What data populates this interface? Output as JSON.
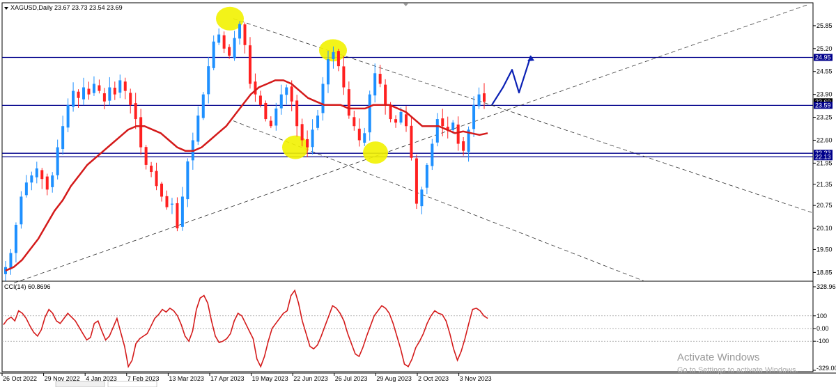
{
  "header": {
    "symbol_line": "XAGUSD,Daily  23.67 23.73 23.54 23.69"
  },
  "indicator": {
    "label": "CCI(14) 60.8696"
  },
  "watermark": {
    "line1": "Activate Windows",
    "line2": "Go to Settings to activate Windows."
  },
  "colors": {
    "bull": "#1e90ff",
    "bear": "#ff2020",
    "ma": "#d41a1a",
    "level": "#00008b",
    "cci": "#d41a1a",
    "trend": "#333333",
    "highlight": "#f2f200",
    "projection": "#0a20b4",
    "price_tag": "#000000"
  },
  "chart_data": [
    {
      "type": "candlestick",
      "title": "XAGUSD,Daily",
      "ohlc_last": {
        "open": 23.67,
        "high": 23.73,
        "low": 23.54,
        "close": 23.69
      },
      "x_labels": [
        "26 Oct 2022",
        "29 Nov 2022",
        "4 Jan 2023",
        "7 Feb 2023",
        "13 Mar 2023",
        "17 Apr 2023",
        "19 May 2023",
        "22 Jun 2023",
        "26 Jul 2023",
        "29 Aug 2023",
        "2 Oct 2023",
        "3 Nov 2023"
      ],
      "y_ticks": [
        25.85,
        25.2,
        24.55,
        23.9,
        23.25,
        22.6,
        21.95,
        21.35,
        20.75,
        20.1,
        19.5,
        18.85
      ],
      "ylim": [
        18.6,
        26.5
      ],
      "horizontal_levels": [
        24.95,
        23.59,
        22.23,
        22.13
      ],
      "price_tags": [
        "24.95",
        "23.69",
        "23.59",
        "22.23",
        "22.13"
      ],
      "close_series": [
        19.0,
        19.4,
        20.2,
        21.0,
        21.4,
        21.6,
        21.8,
        21.5,
        21.2,
        21.6,
        22.4,
        23.0,
        23.6,
        24.0,
        23.8,
        24.1,
        23.9,
        24.2,
        24.0,
        23.7,
        24.1,
        23.9,
        24.3,
        24.0,
        23.6,
        23.2,
        22.4,
        21.9,
        21.7,
        21.3,
        21.0,
        20.7,
        20.8,
        20.1,
        21.0,
        22.0,
        22.6,
        23.3,
        23.9,
        24.7,
        25.4,
        25.6,
        25.2,
        25.0,
        25.5,
        25.9,
        25.3,
        24.2,
        23.9,
        23.6,
        23.2,
        23.0,
        23.5,
        23.9,
        24.1,
        23.7,
        23.0,
        22.6,
        22.4,
        22.9,
        23.3,
        24.2,
        24.9,
        25.1,
        24.7,
        24.1,
        23.3,
        23.0,
        22.6,
        22.8,
        23.9,
        24.5,
        24.2,
        23.6,
        23.2,
        23.1,
        23.4,
        23.0,
        22.1,
        20.8,
        21.2,
        21.9,
        22.5,
        23.2,
        23.0,
        22.9,
        23.1,
        22.5,
        22.3,
        22.9,
        23.6,
        23.9,
        23.69
      ],
      "moving_average_series": [
        18.9,
        19.0,
        19.2,
        19.5,
        19.8,
        20.2,
        20.6,
        20.9,
        21.3,
        21.6,
        21.9,
        22.1,
        22.3,
        22.5,
        22.7,
        22.9,
        23.0,
        23.0,
        22.9,
        22.8,
        22.6,
        22.4,
        22.3,
        22.3,
        22.4,
        22.6,
        22.8,
        23.0,
        23.3,
        23.6,
        23.9,
        24.1,
        24.2,
        24.3,
        24.3,
        24.2,
        24.0,
        23.8,
        23.7,
        23.6,
        23.6,
        23.6,
        23.5,
        23.5,
        23.5,
        23.6,
        23.6,
        23.6,
        23.5,
        23.4,
        23.2,
        23.0,
        23.0,
        23.0,
        22.9,
        22.8,
        22.85,
        22.8,
        22.75,
        22.8
      ],
      "projection_path": [
        23.6,
        24.1,
        24.6,
        23.95,
        25.0
      ],
      "annotations": [
        "tops circled at ~25.9 and ~25.2",
        "bottoms circled at ~22.3"
      ]
    },
    {
      "type": "line",
      "title": "CCI(14) 60.8696",
      "y_ticks": [
        328.964,
        100,
        0.0,
        -100,
        -329.0
      ],
      "y_tick_labels": [
        "328.964",
        "100",
        "0.00",
        "-100",
        "-329.00"
      ],
      "ylim": [
        -329.0,
        328.964
      ],
      "values": [
        30,
        70,
        90,
        60,
        140,
        120,
        80,
        20,
        -30,
        -60,
        -10,
        90,
        150,
        120,
        60,
        40,
        80,
        120,
        90,
        60,
        10,
        -40,
        -90,
        -70,
        40,
        60,
        -20,
        -90,
        -60,
        10,
        80,
        -30,
        -140,
        -300,
        -250,
        -120,
        -80,
        -60,
        -40,
        20,
        80,
        110,
        150,
        130,
        160,
        140,
        100,
        30,
        -60,
        -100,
        -20,
        150,
        240,
        260,
        200,
        60,
        -60,
        -110,
        -100,
        -80,
        -40,
        60,
        120,
        100,
        40,
        -20,
        -80,
        -240,
        -300,
        -220,
        -100,
        0,
        40,
        80,
        120,
        140,
        260,
        300,
        200,
        60,
        -40,
        -140,
        -160,
        -130,
        -60,
        20,
        100,
        180,
        160,
        120,
        60,
        -40,
        -120,
        -200,
        -220,
        -150,
        -60,
        20,
        100,
        140,
        180,
        160,
        120,
        40,
        -60,
        -160,
        -280,
        -300,
        -240,
        -150,
        -100,
        -40,
        40,
        100,
        140,
        120,
        110,
        60,
        -40,
        -160,
        -250,
        -180,
        -80,
        40,
        150,
        160,
        140,
        100,
        80
      ]
    }
  ]
}
